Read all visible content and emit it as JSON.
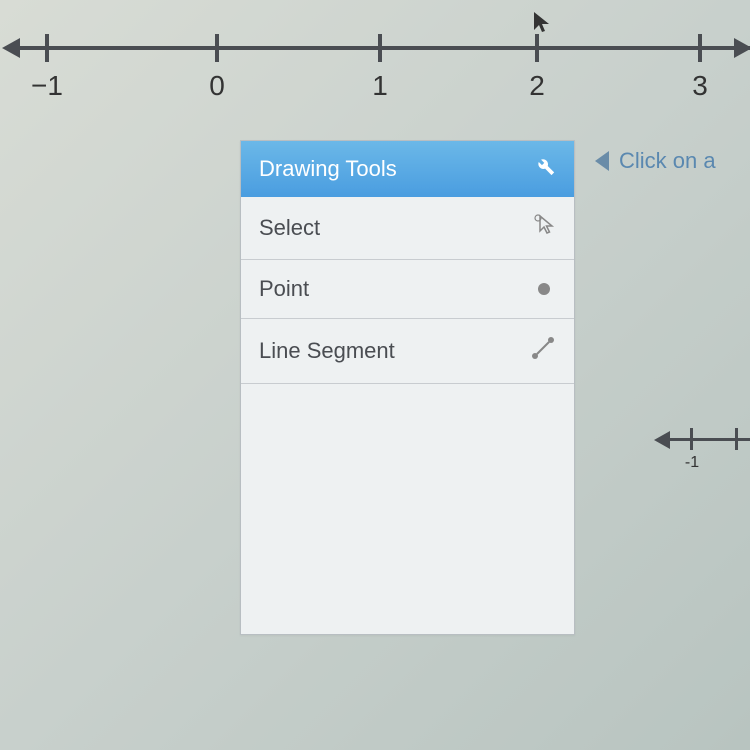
{
  "numberline": {
    "ticks": [
      {
        "value": "−1",
        "pos": 45
      },
      {
        "value": "0",
        "pos": 215
      },
      {
        "value": "1",
        "pos": 378
      },
      {
        "value": "2",
        "pos": 535
      },
      {
        "value": "3",
        "pos": 698
      }
    ]
  },
  "tools": {
    "header": "Drawing Tools",
    "items": [
      {
        "label": "Select",
        "icon": "cursor-icon"
      },
      {
        "label": "Point",
        "icon": "point-icon"
      },
      {
        "label": "Line Segment",
        "icon": "segment-icon"
      }
    ]
  },
  "hint": {
    "text": "Click on a"
  },
  "small_numberline": {
    "ticks": [
      {
        "value": "-1",
        "pos": 40
      },
      {
        "value": "",
        "pos": 85
      }
    ]
  }
}
